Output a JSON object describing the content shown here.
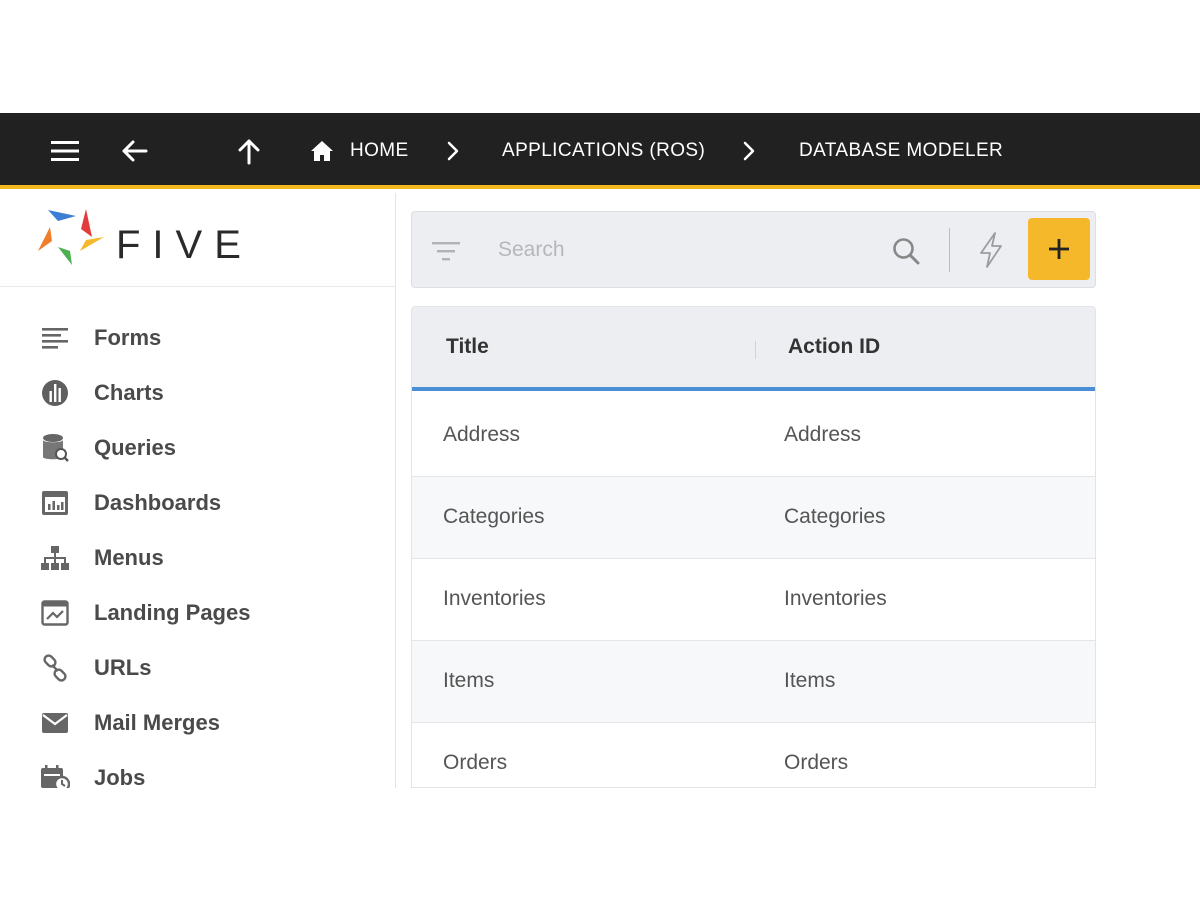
{
  "topbar": {
    "breadcrumbs": [
      "HOME",
      "APPLICATIONS (ROS)",
      "DATABASE MODELER"
    ]
  },
  "logo": {
    "text": "FIVE"
  },
  "sidebar": {
    "items": [
      {
        "label": "Forms",
        "icon": "forms-icon"
      },
      {
        "label": "Charts",
        "icon": "charts-icon"
      },
      {
        "label": "Queries",
        "icon": "queries-icon"
      },
      {
        "label": "Dashboards",
        "icon": "dashboards-icon"
      },
      {
        "label": "Menus",
        "icon": "menus-icon"
      },
      {
        "label": "Landing Pages",
        "icon": "landing-pages-icon"
      },
      {
        "label": "URLs",
        "icon": "urls-icon"
      },
      {
        "label": "Mail Merges",
        "icon": "mail-merges-icon"
      },
      {
        "label": "Jobs",
        "icon": "jobs-icon"
      }
    ]
  },
  "toolbar": {
    "search_placeholder": "Search"
  },
  "grid": {
    "columns": [
      "Title",
      "Action ID"
    ],
    "rows": [
      [
        "Address",
        "Address"
      ],
      [
        "Categories",
        "Categories"
      ],
      [
        "Inventories",
        "Inventories"
      ],
      [
        "Items",
        "Items"
      ],
      [
        "Orders",
        "Orders"
      ]
    ]
  },
  "colors": {
    "topbar_bg": "#212121",
    "accent_yellow": "#f5b82b",
    "header_underline_blue": "#4a8fd6",
    "nav_text": "#4a4a4a"
  }
}
